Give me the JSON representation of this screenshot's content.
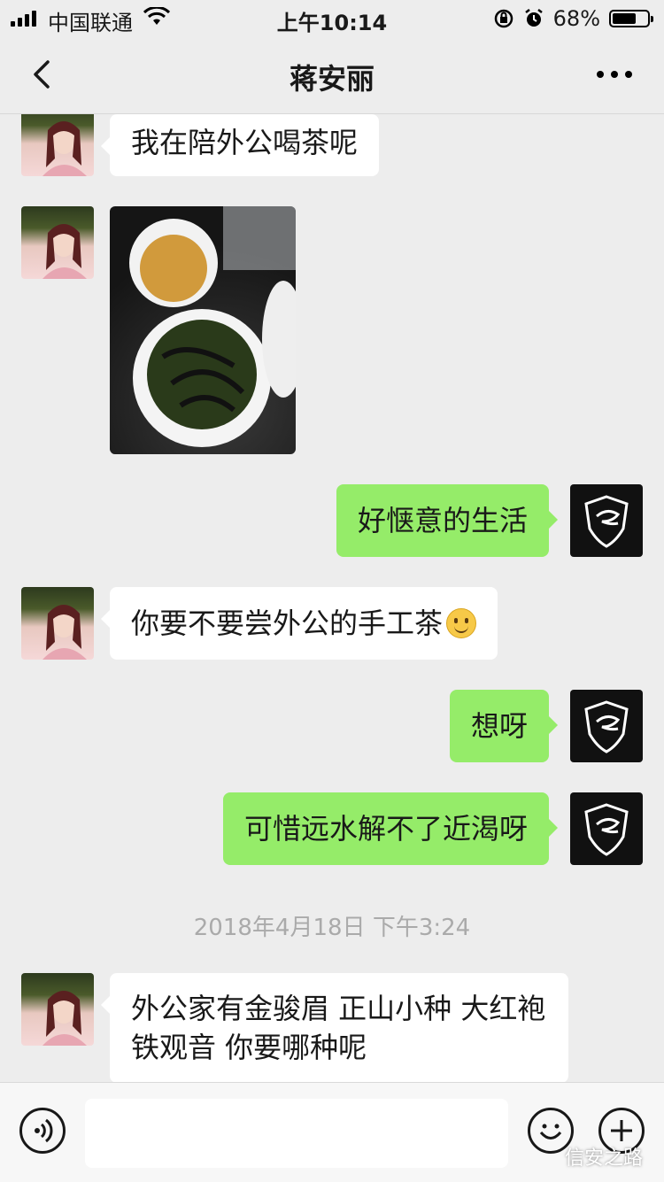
{
  "status_bar": {
    "carrier": "中国联通",
    "time": "上午10:14",
    "battery": "68%",
    "battery_level": 0.68
  },
  "nav": {
    "title": "蒋安丽"
  },
  "messages": [
    {
      "side": "left",
      "type": "text",
      "text": "我在陪外公喝茶呢"
    },
    {
      "side": "left",
      "type": "image"
    },
    {
      "side": "right",
      "type": "text",
      "text": "好惬意的生活"
    },
    {
      "side": "left",
      "type": "text",
      "text": "你要不要尝外公的手工茶",
      "emoji": "smile-emoji"
    },
    {
      "side": "right",
      "type": "text",
      "text": "想呀"
    },
    {
      "side": "right",
      "type": "text",
      "text": "可惜远水解不了近渴呀"
    },
    {
      "side": "left",
      "type": "text",
      "text": "外公家有金骏眉 正山小种 大红袍 铁观音 你要哪种呢"
    }
  ],
  "timestamp": "2018年4月18日 下午3:24",
  "watermark": "信安之路",
  "colors": {
    "sent_bubble": "#95ec69",
    "received_bubble": "#ffffff",
    "background": "#ededed"
  }
}
